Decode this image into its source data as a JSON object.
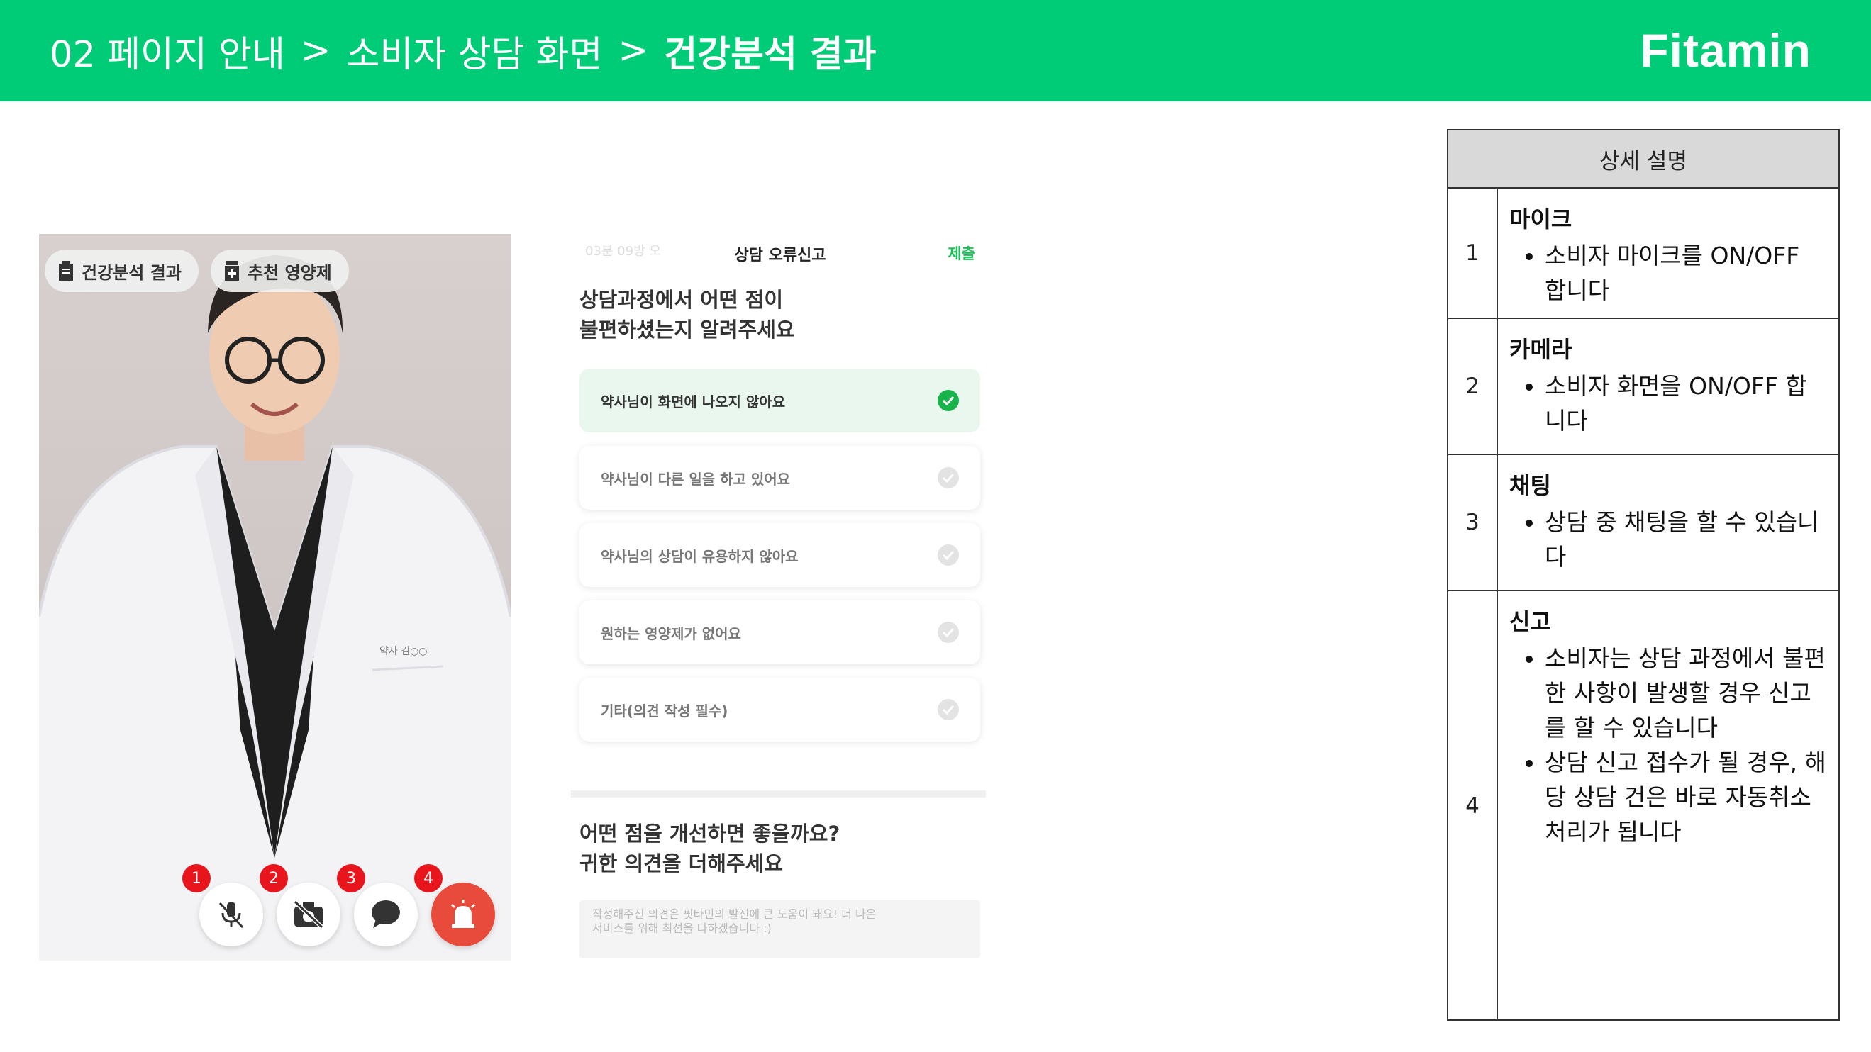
{
  "header": {
    "breadcrumb": [
      "02 페이지 안내",
      "소비자 상담 화면"
    ],
    "separator": ">",
    "current": "건강분석 결과",
    "brand": "Fitamin"
  },
  "video": {
    "chips": [
      "건강분석 결과",
      "추천 영양제"
    ],
    "coat_name_tag": "약사 김○○",
    "controls": [
      {
        "badge": "1",
        "icon": "mic-off-icon"
      },
      {
        "badge": "2",
        "icon": "camera-off-icon"
      },
      {
        "badge": "3",
        "icon": "chat-bubble-icon"
      },
      {
        "badge": "4",
        "icon": "siren-alert-icon"
      }
    ]
  },
  "report": {
    "faded_header": "03분 09방 오",
    "title": "상담 오류신고",
    "submit": "제출",
    "question_line1": "상담과정에서 어떤 점이",
    "question_line2": "불편하셨는지 알려주세요",
    "options": [
      {
        "label": "약사님이 화면에 나오지 않아요",
        "selected": true
      },
      {
        "label": "약사님이 다른 일을 하고 있어요",
        "selected": false
      },
      {
        "label": "약사님의 상담이 유용하지 않아요",
        "selected": false
      },
      {
        "label": "원하는 영양제가 없어요",
        "selected": false
      },
      {
        "label": "기타(의견 작성 필수)",
        "selected": false
      }
    ],
    "feedback_line1": "어떤 점을 개선하면 좋을까요?",
    "feedback_line2": "귀한 의견을 더해주세요",
    "textarea_placeholder_line1": "작성해주신 의견은 핏타민의 발전에 큰 도움이 돼요! 더 나은",
    "textarea_placeholder_line2": "서비스를 위해 최선을 다하겠습니다 :)"
  },
  "spec": {
    "header": "상세 설명",
    "rows": [
      {
        "num": "1",
        "title": "마이크",
        "bullets": [
          "소비자 마이크를 ON/OFF 합니다"
        ]
      },
      {
        "num": "2",
        "title": "카메라",
        "bullets": [
          "소비자 화면을 ON/OFF 합니다"
        ]
      },
      {
        "num": "3",
        "title": "채팅",
        "bullets": [
          "상담 중 채팅을 할 수 있습니다"
        ]
      },
      {
        "num": "4",
        "title": "신고",
        "bullets": [
          "소비자는 상담 과정에서 불편한 사항이 발생할 경우 신고를 할 수 있습니다",
          "상담 신고 접수가 될 경우, 해당 상담 건은 바로 자동취소 처리가 됩니다"
        ]
      }
    ]
  },
  "colors": {
    "brand_green": "#00cc77",
    "badge_red": "#e8151c",
    "alert_red": "#e84b3c",
    "check_green": "#18b34a"
  }
}
